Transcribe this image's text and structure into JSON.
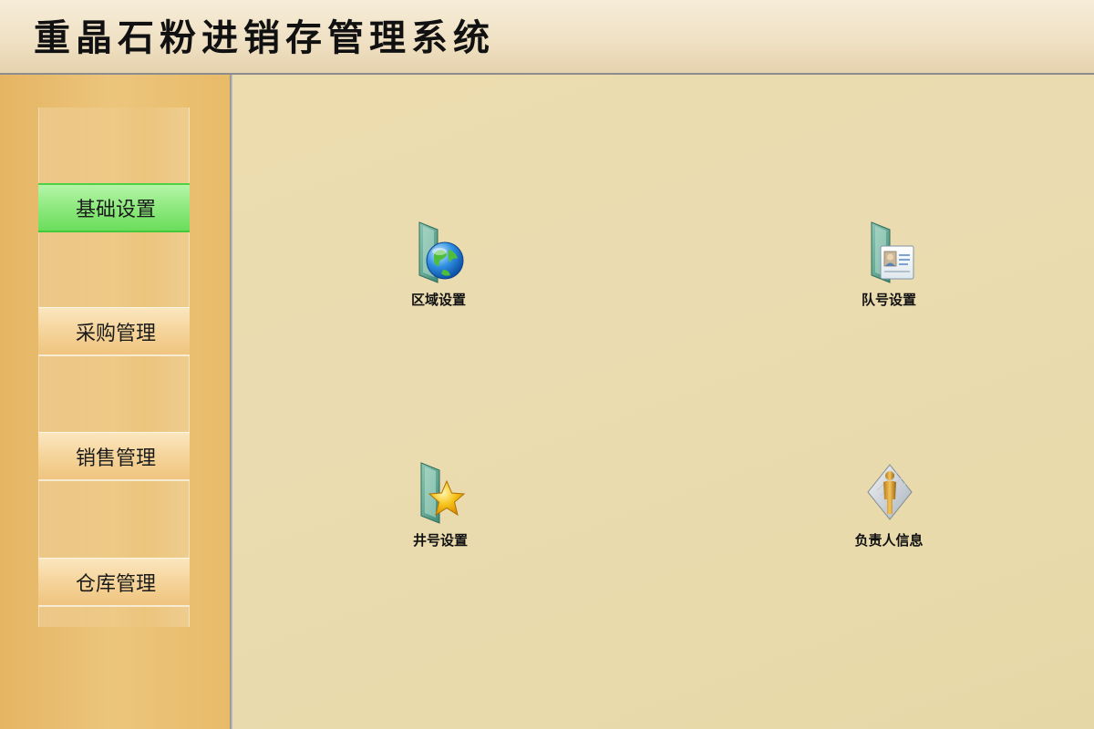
{
  "header": {
    "title": "重晶石粉进销存管理系统"
  },
  "sidebar": {
    "items": [
      {
        "label": "基础设置",
        "active": true
      },
      {
        "label": "采购管理",
        "active": false
      },
      {
        "label": "销售管理",
        "active": false
      },
      {
        "label": "仓库管理",
        "active": false
      }
    ]
  },
  "main": {
    "tiles": [
      {
        "label": "区域设置",
        "icon": "folder-globe-icon"
      },
      {
        "label": "队号设置",
        "icon": "folder-contact-card-icon"
      },
      {
        "label": "井号设置",
        "icon": "folder-star-icon"
      },
      {
        "label": "负责人信息",
        "icon": "person-document-icon"
      }
    ]
  },
  "colors": {
    "header_bg": "#efe0c2",
    "sidebar_bg": "#ecc57c",
    "nav_button": "#f5d49a",
    "nav_active": "#8ee97e",
    "content_bg": "#eadcb0"
  }
}
